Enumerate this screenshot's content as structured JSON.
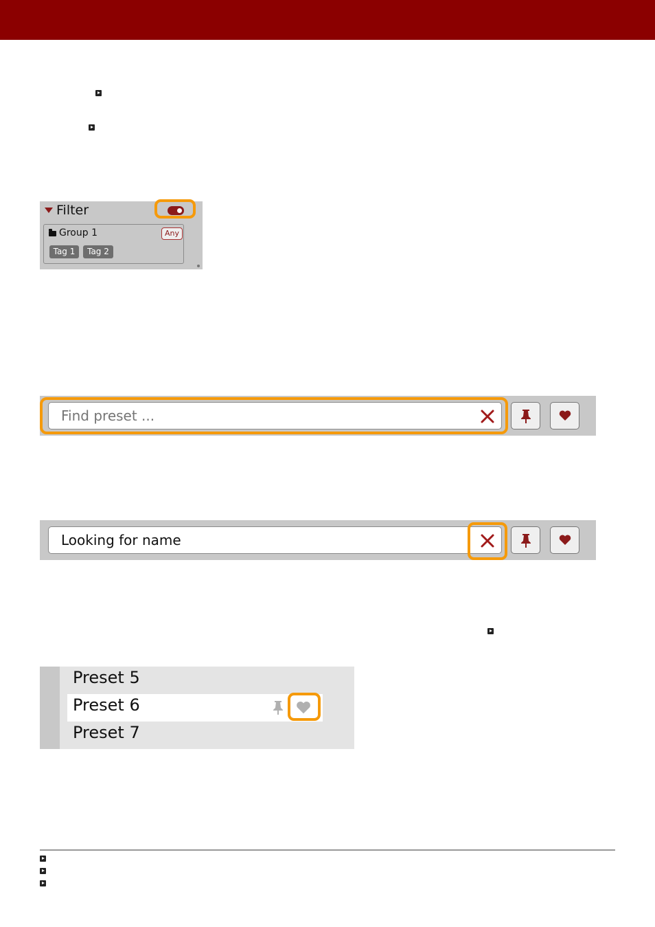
{
  "colors": {
    "header": "#8b0000",
    "accent": "#8b1a1a",
    "highlight": "#f59a0b",
    "panel": "#c8c8c8"
  },
  "filter_panel": {
    "title": "Filter",
    "toggle_on": true,
    "group": {
      "label": "Group 1",
      "mode": "Any",
      "tags": [
        "Tag 1",
        "Tag 2"
      ]
    }
  },
  "search_bar_empty": {
    "placeholder": "Find preset ...",
    "icons": [
      "close-icon",
      "pin-icon",
      "heart-icon"
    ]
  },
  "search_bar_filled": {
    "value": "Looking for name",
    "icons": [
      "close-icon",
      "pin-icon",
      "heart-icon"
    ]
  },
  "preset_list": {
    "items": [
      "Preset 5",
      "Preset 6",
      "Preset 7"
    ],
    "selected_index": 1
  }
}
